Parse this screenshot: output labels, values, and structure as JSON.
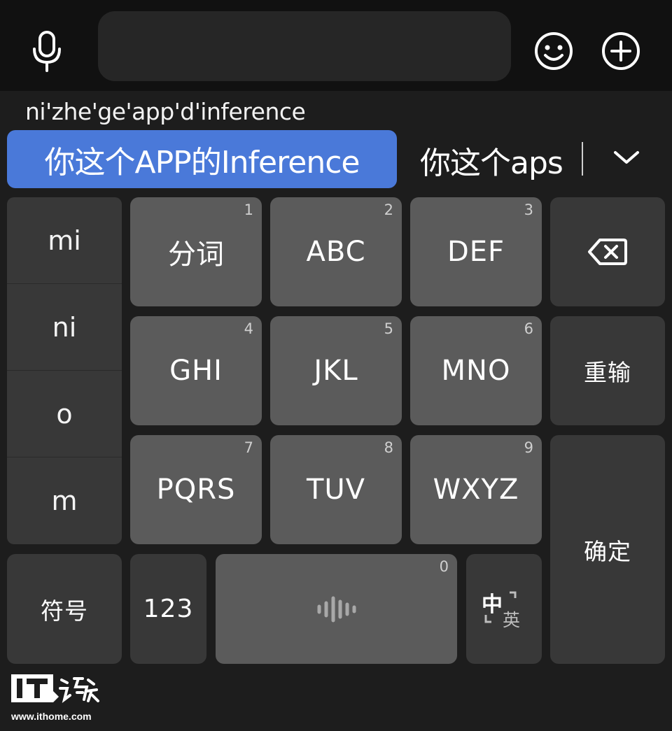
{
  "composition": {
    "pinyin": "ni'zhe'ge'app'd'inference",
    "candidates": [
      "你这个APP的Inference",
      "你这个aps"
    ]
  },
  "side_candidates": [
    "mi",
    "ni",
    "o",
    "m"
  ],
  "keys": [
    {
      "label": "分词",
      "num": "1"
    },
    {
      "label": "ABC",
      "num": "2"
    },
    {
      "label": "DEF",
      "num": "3"
    },
    {
      "label": "GHI",
      "num": "4"
    },
    {
      "label": "JKL",
      "num": "5"
    },
    {
      "label": "MNO",
      "num": "6"
    },
    {
      "label": "PQRS",
      "num": "7"
    },
    {
      "label": "TUV",
      "num": "8"
    },
    {
      "label": "WXYZ",
      "num": "9"
    }
  ],
  "function_keys": {
    "reenter": "重输",
    "confirm": "确定",
    "symbols": "符号",
    "numbers": "123",
    "space_num": "0",
    "lang_main": "中",
    "lang_sub": "英"
  },
  "watermark": {
    "logo_text": "IT",
    "url": "www.ithome.com"
  },
  "icons": [
    "microphone-icon",
    "emoji-icon",
    "plus-icon",
    "chevron-down-icon",
    "backspace-icon",
    "voice-wave-icon",
    "language-switch-icon"
  ],
  "colors": {
    "candidate_highlight": "#4a79d9",
    "key_bg": "#5b5b5b",
    "fn_key_bg": "#383838",
    "keyboard_bg": "#1d1d1d"
  }
}
